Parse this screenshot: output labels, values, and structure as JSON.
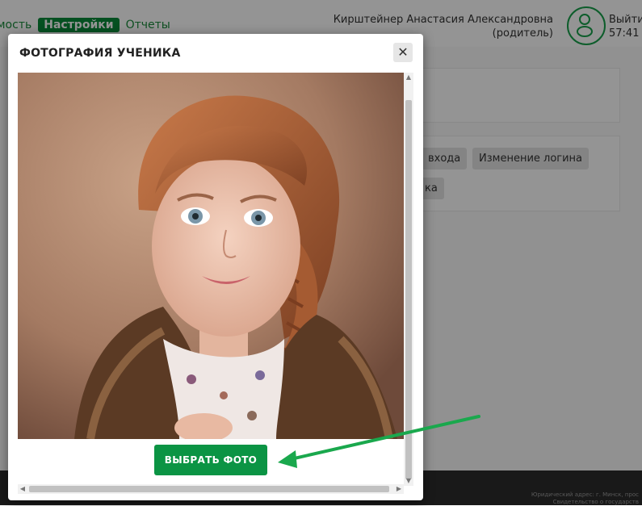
{
  "nav": {
    "items": [
      "мость",
      "Настройки",
      "Отчеты"
    ],
    "active_index": 1
  },
  "user": {
    "name": "Кирштейнер Анастасия Александровна",
    "role": "(родитель)"
  },
  "session": {
    "logout_label": "Выйти",
    "timer": "57:41"
  },
  "settings": {
    "chips": [
      "входа",
      "Изменение логина",
      "ка"
    ]
  },
  "footer": {
    "address_line1": "Юридический адрес: г. Минск, прос",
    "address_line2": "Свидетельство о государств"
  },
  "modal": {
    "title": "ФОТОГРАФИЯ УЧЕНИКА",
    "close_symbol": "✕",
    "choose_button": "ВЫБРАТЬ ФОТО"
  },
  "icons": {
    "avatar": "user-circle-icon",
    "close": "close-icon",
    "annotation": "green-arrow-icon"
  },
  "colors": {
    "brand_green": "#0b9444",
    "arrow_green": "#1aa84d",
    "overlay": "rgba(0,0,0,0.42)"
  }
}
